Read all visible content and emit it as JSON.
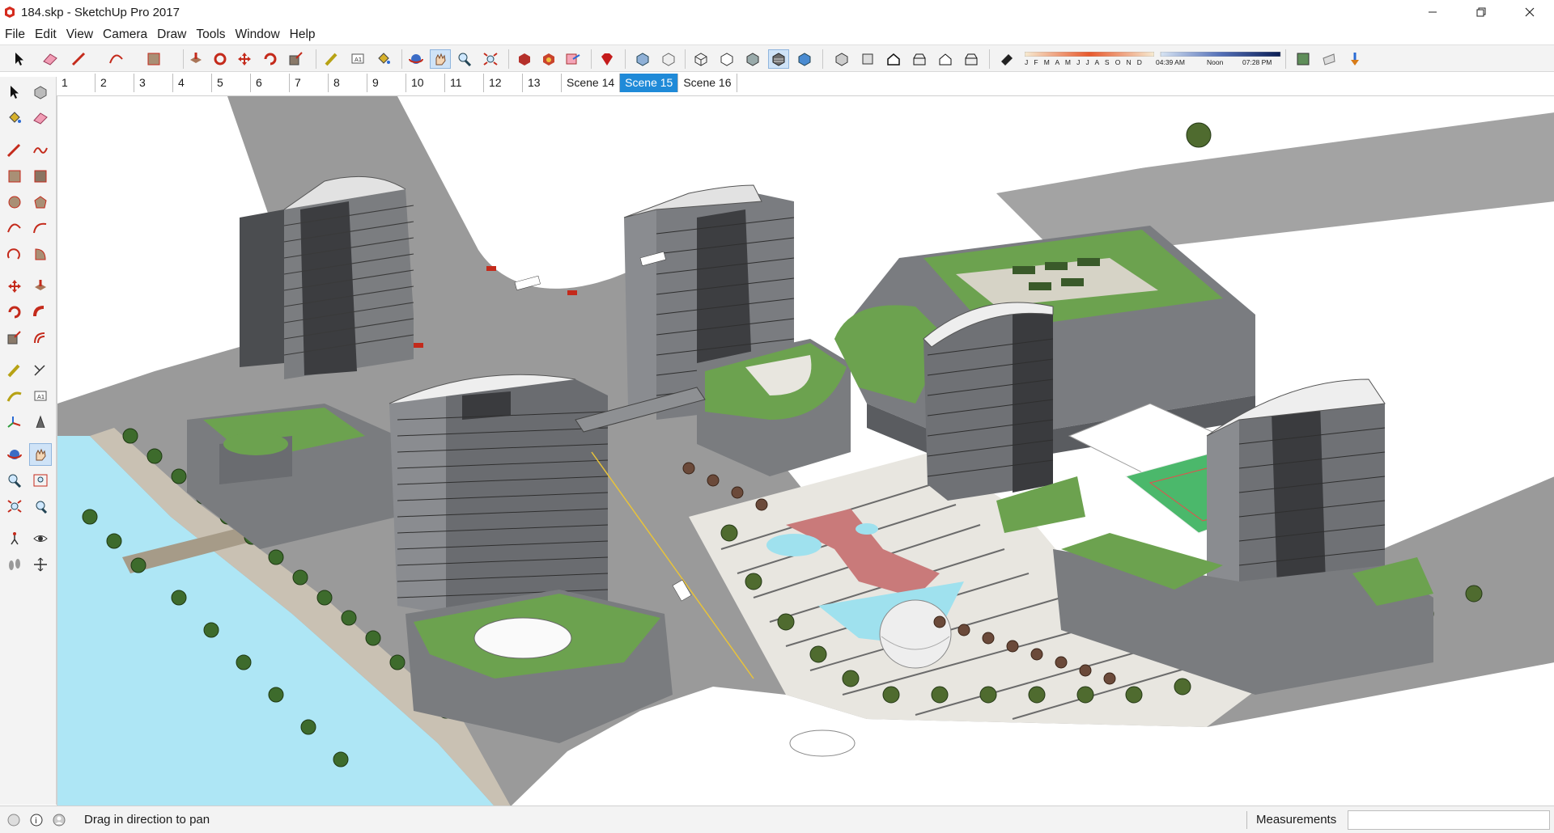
{
  "window": {
    "title": "184.skp - SketchUp Pro 2017",
    "controls": [
      "minimize-icon",
      "restore-icon",
      "close-icon"
    ]
  },
  "menu": [
    "File",
    "Edit",
    "View",
    "Camera",
    "Draw",
    "Tools",
    "Window",
    "Help"
  ],
  "toolbar": {
    "months_label": "J F M A M J J A S O N D",
    "time_start": "04:39 AM",
    "time_mid": "Noon",
    "time_end": "07:28 PM",
    "icons": [
      "select-icon",
      "eraser-icon",
      "line-icon",
      "arc-icon",
      "rectangle-icon",
      "push-pull-icon",
      "follow-me-icon",
      "move-icon",
      "rotate-icon",
      "scale-icon",
      "tape-measure-icon",
      "text-icon",
      "paint-bucket-icon",
      "orbit-icon",
      "pan-icon",
      "zoom-icon",
      "zoom-extents-icon",
      "3d-warehouse-icon",
      "extension-warehouse-icon",
      "layout-icon",
      "ruby-icon",
      "xray-icon",
      "back-edges-icon",
      "wireframe-icon",
      "hidden-line-icon",
      "shaded-icon",
      "shaded-textures-icon",
      "monochrome-icon",
      "iso-view-icon",
      "top-view-icon",
      "front-view-icon",
      "right-view-icon",
      "back-view-icon",
      "left-view-icon",
      "shadows-icon",
      "section-plane-icon",
      "fog-icon",
      "add-location-icon"
    ]
  },
  "scenes": {
    "tabs": [
      "1",
      "2",
      "3",
      "4",
      "5",
      "6",
      "7",
      "8",
      "9",
      "10",
      "11",
      "12",
      "13",
      "Scene 14",
      "Scene 15",
      "Scene 16"
    ],
    "active": "Scene 15"
  },
  "left_palette": [
    "select-icon",
    "make-component-icon",
    "paint-bucket-icon",
    "eraser-icon",
    "line-icon",
    "freehand-icon",
    "rectangle-icon",
    "rotated-rectangle-icon",
    "circle-icon",
    "polygon-icon",
    "arc-icon",
    "two-point-arc-icon",
    "three-point-arc-icon",
    "pie-icon",
    "move-icon",
    "push-pull-icon",
    "rotate-icon",
    "follow-me-icon",
    "scale-icon",
    "offset-icon",
    "tape-measure-icon",
    "dimension-icon",
    "protractor-icon",
    "text-icon",
    "axes-icon",
    "3d-text-icon",
    "orbit-icon",
    "pan-icon",
    "zoom-icon",
    "zoom-window-icon",
    "zoom-extents-icon",
    "previous-view-icon",
    "position-camera-icon",
    "look-around-icon",
    "walk-icon",
    "section-plane-icon"
  ],
  "status": {
    "hint": "Drag in direction to pan",
    "measurements_label": "Measurements",
    "measurements_value": ""
  },
  "colors": {
    "accent": "#1f8ad8",
    "sky": "#ffffff",
    "road": "#9a9a9a",
    "grass": "#6fa84c",
    "water": "#aee6f5",
    "building": "#8a8c8e",
    "court": "#4bb86b"
  }
}
